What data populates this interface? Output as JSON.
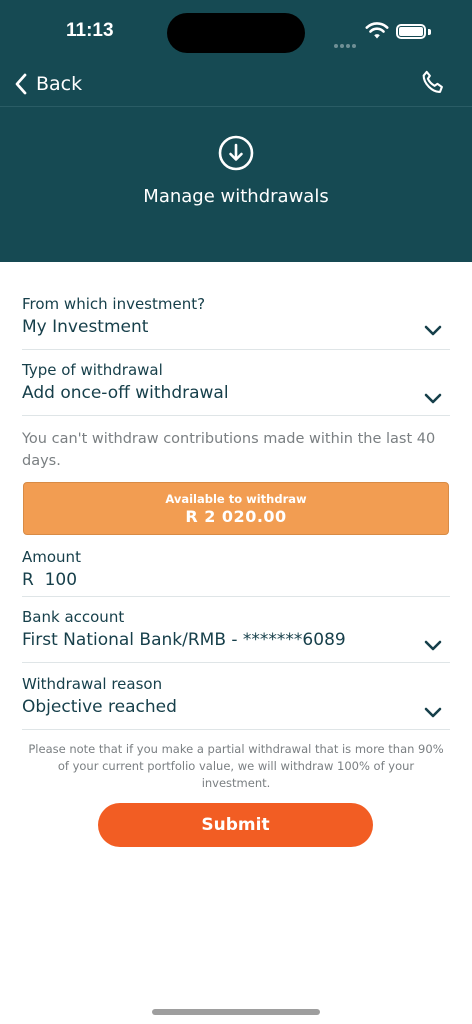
{
  "status_bar": {
    "time": "11:13"
  },
  "nav": {
    "back_label": "Back",
    "icons": {
      "back": "chevron-left-icon",
      "call": "phone-icon"
    }
  },
  "header": {
    "title": "Manage withdrawals",
    "icon": "download-circle-icon"
  },
  "form": {
    "investment": {
      "label": "From which investment?",
      "value": "My Investment"
    },
    "withdrawal_type": {
      "label": "Type of withdrawal",
      "value": "Add once-off withdrawal"
    },
    "note": "You can't withdraw contributions made within the last 40 days.",
    "available": {
      "label": "Available to withdraw",
      "amount": "R 2 020.00"
    },
    "amount": {
      "label": "Amount",
      "value": "R  100"
    },
    "bank_account": {
      "label": "Bank account",
      "value": "First National Bank/RMB - *******6089"
    },
    "reason": {
      "label": "Withdrawal reason",
      "value": "Objective reached"
    },
    "disclaimer": "Please note that if you make a partial withdrawal that is more than 90% of your current portfolio value, we will withdraw 100% of your investment.",
    "submit_label": "Submit"
  },
  "colors": {
    "header_bg": "#164a53",
    "text_primary": "#163f4a",
    "available_bg": "#f29d52",
    "submit_bg": "#f25d23"
  }
}
